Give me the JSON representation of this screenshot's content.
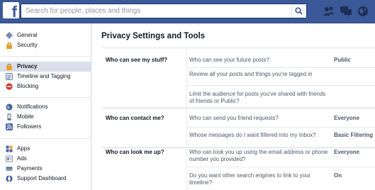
{
  "search": {
    "placeholder": "Search for people, places and things"
  },
  "header": {
    "logo_letter": "f",
    "icons": [
      "friend-requests-icon",
      "messages-icon",
      "notifications-globe-icon"
    ],
    "brand_color": "#3b5998"
  },
  "sidebar": {
    "groups": [
      [
        {
          "label": "General",
          "icon": "gear-icon",
          "color": "#6d84b4"
        },
        {
          "label": "Security",
          "icon": "lock-icon",
          "color": "#e7a12b"
        }
      ],
      [
        {
          "label": "Privacy",
          "icon": "lock-icon",
          "color": "#e7a12b",
          "active": true
        },
        {
          "label": "Timeline and Tagging",
          "icon": "timeline-icon",
          "color": "#5b74a8"
        },
        {
          "label": "Blocking",
          "icon": "blocking-icon",
          "color": "#d5352c"
        }
      ],
      [
        {
          "label": "Notifications",
          "icon": "globe-icon",
          "color": "#4a66a0"
        },
        {
          "label": "Mobile",
          "icon": "mobile-icon",
          "color": "#5a6f8a"
        },
        {
          "label": "Followers",
          "icon": "rss-icon",
          "color": "#4a66a0"
        }
      ],
      [
        {
          "label": "Apps",
          "icon": "apps-icon",
          "color": "#4a66a0"
        },
        {
          "label": "Ads",
          "icon": "ads-icon",
          "color": "#7a8aa6"
        },
        {
          "label": "Payments",
          "icon": "payments-icon",
          "color": "#8a9bb5"
        },
        {
          "label": "Support Dashboard",
          "icon": "support-icon",
          "color": "#3b5998"
        }
      ]
    ]
  },
  "main": {
    "title": "Privacy Settings and Tools",
    "sections": [
      {
        "label": "Who can see my stuff?",
        "rows": [
          {
            "question": "Who can see your future posts?",
            "value": "Public"
          },
          {
            "question": "Review all your posts and things you're tagged in",
            "value": ""
          },
          {
            "question": "Limit the audience for posts you've shared with friends of friends or Public?",
            "value": ""
          }
        ]
      },
      {
        "label": "Who can contact me?",
        "rows": [
          {
            "question": "Who can send you friend requests?",
            "value": "Everyone"
          },
          {
            "question": "Whose messages do I want filtered into my Inbox?",
            "value": "Basic Filtering"
          }
        ]
      },
      {
        "label": "Who can look me up?",
        "rows": [
          {
            "question": "Who can look you up using the email address or phone number you provided?",
            "value": "Everyone"
          },
          {
            "question": "Do you want other search engines to link to your timeline?",
            "value": "On"
          }
        ]
      }
    ]
  }
}
